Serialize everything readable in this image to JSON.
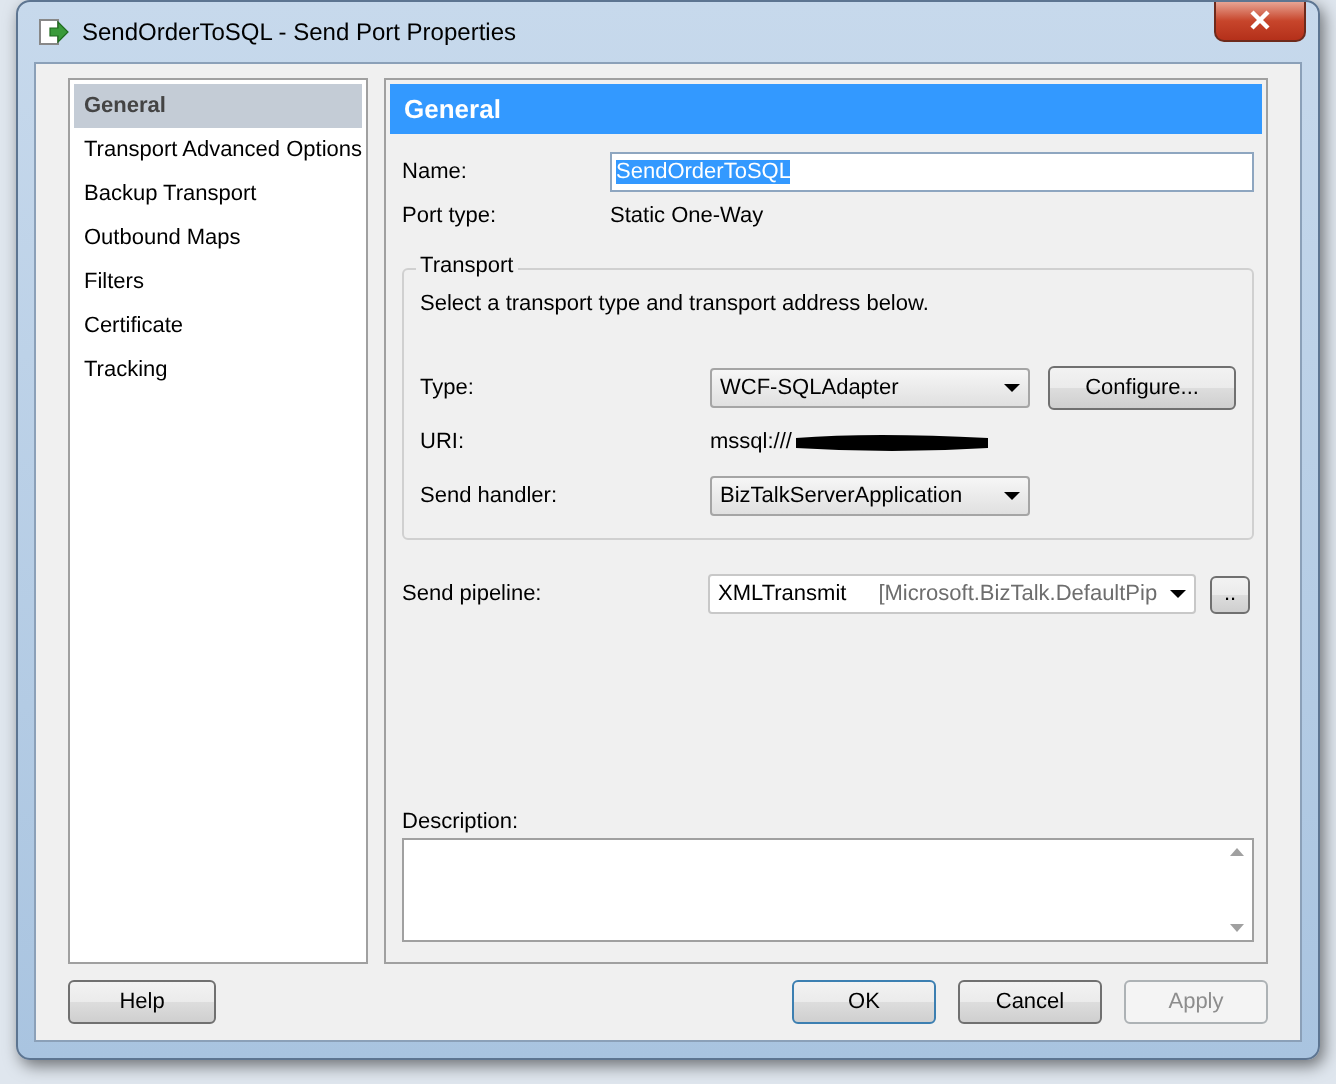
{
  "window": {
    "title": "SendOrderToSQL - Send Port Properties"
  },
  "sidebar": {
    "items": [
      {
        "label": "General",
        "selected": true
      },
      {
        "label": "Transport Advanced Options",
        "selected": false
      },
      {
        "label": "Backup Transport",
        "selected": false
      },
      {
        "label": "Outbound Maps",
        "selected": false
      },
      {
        "label": "Filters",
        "selected": false
      },
      {
        "label": "Certificate",
        "selected": false
      },
      {
        "label": "Tracking",
        "selected": false
      }
    ]
  },
  "panel": {
    "header": "General",
    "name": {
      "label": "Name:",
      "value": "SendOrderToSQL",
      "text_selected": true
    },
    "port_type": {
      "label": "Port type:",
      "value": "Static One-Way"
    },
    "transport": {
      "title": "Transport",
      "hint": "Select a transport type and transport address below.",
      "type": {
        "label": "Type:",
        "value": "WCF-SQLAdapter"
      },
      "configure_button": "Configure...",
      "uri": {
        "label": "URI:",
        "value": "mssql:///",
        "redacted": true
      },
      "send_handler": {
        "label": "Send handler:",
        "value": "BizTalkServerApplication"
      }
    },
    "send_pipeline": {
      "label": "Send pipeline:",
      "value": "XMLTransmit",
      "detail": "[Microsoft.BizTalk.DefaultPip",
      "browse_button": ".."
    },
    "description": {
      "label": "Description:"
    }
  },
  "buttons": {
    "help": {
      "label": "Help",
      "disabled": false
    },
    "ok": {
      "label": "OK",
      "disabled": false
    },
    "cancel": {
      "label": "Cancel",
      "disabled": false
    },
    "apply": {
      "label": "Apply",
      "disabled": true
    }
  }
}
